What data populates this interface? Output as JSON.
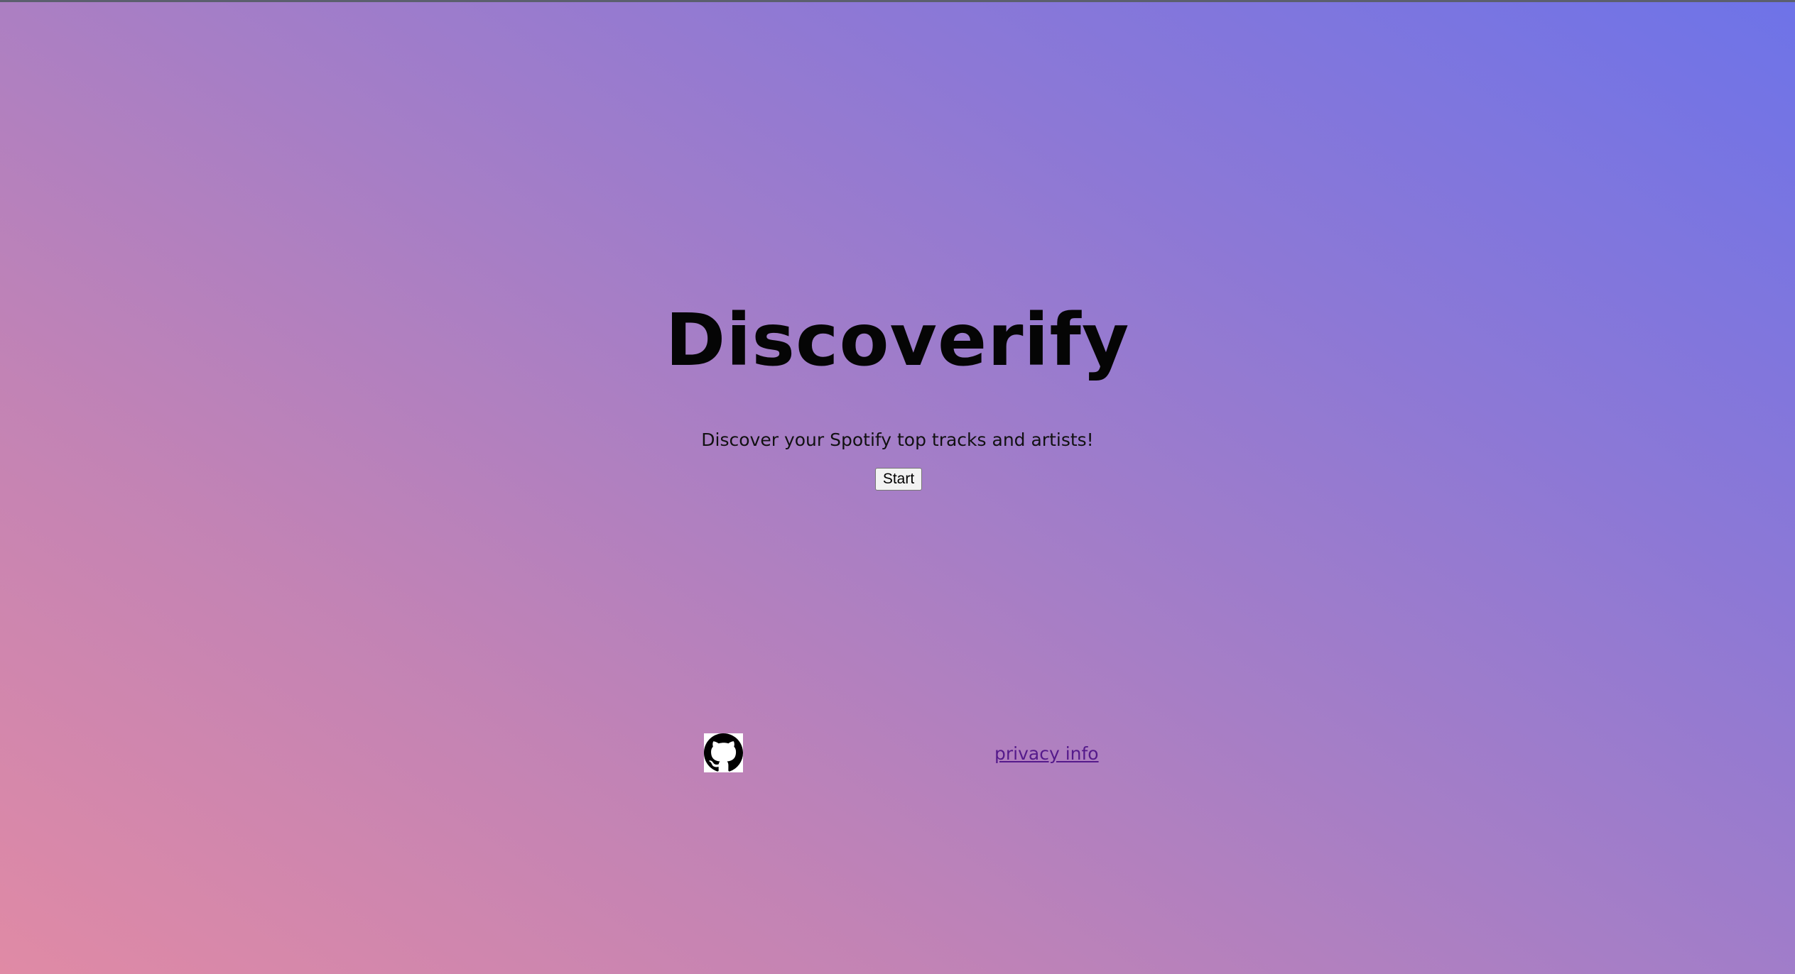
{
  "app": {
    "title": "Discoverify",
    "subtitle": "Discover your Spotify top tracks and artists!"
  },
  "actions": {
    "start_label": "Start"
  },
  "footer": {
    "github_icon": "github-icon",
    "privacy_label": "privacy info"
  },
  "colors": {
    "gradient_start": "#e08aa5",
    "gradient_end": "#6e73e8",
    "link": "#551a8b"
  }
}
